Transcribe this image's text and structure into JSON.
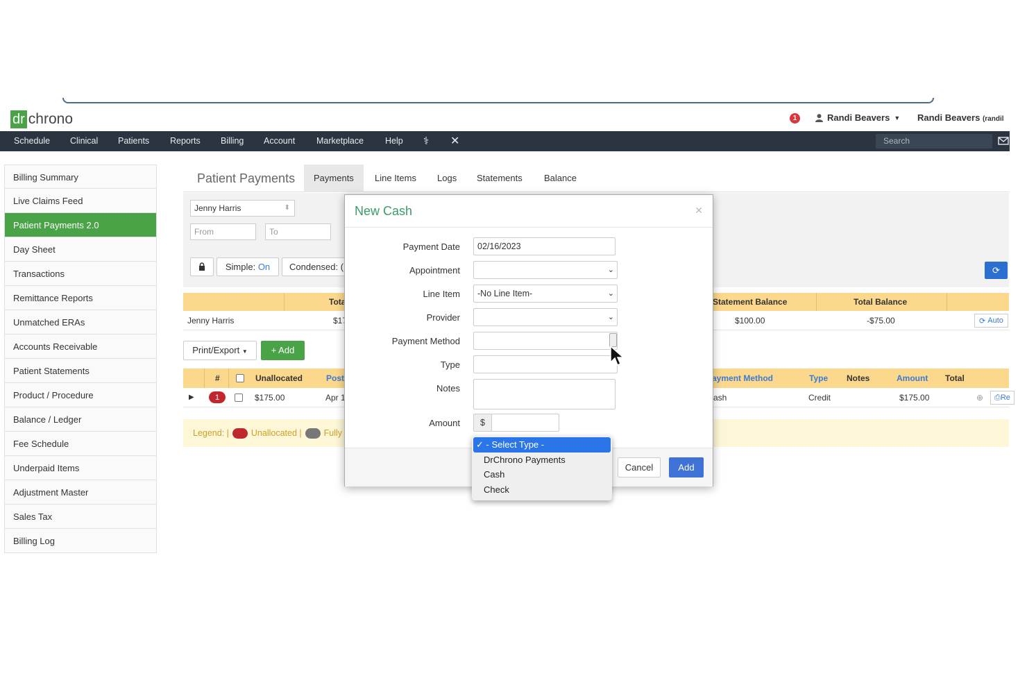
{
  "header": {
    "logo_dr": "dr",
    "logo_chrono": "chrono",
    "alert_count": "1",
    "user_name": "Randi Beavers",
    "user_name2": "Randi Beavers",
    "user_suffix": "(randil"
  },
  "nav": {
    "items": [
      "Schedule",
      "Clinical",
      "Patients",
      "Reports",
      "Billing",
      "Account",
      "Marketplace",
      "Help"
    ],
    "search_placeholder": "Search"
  },
  "sidebar": {
    "items": [
      {
        "label": "Billing Summary"
      },
      {
        "label": "Live Claims Feed"
      },
      {
        "label": "Patient Payments 2.0"
      },
      {
        "label": "Day Sheet"
      },
      {
        "label": "Transactions"
      },
      {
        "label": "Remittance Reports"
      },
      {
        "label": "Unmatched ERAs"
      },
      {
        "label": "Accounts Receivable"
      },
      {
        "label": "Patient Statements"
      },
      {
        "label": "Product / Procedure"
      },
      {
        "label": "Balance / Ledger"
      },
      {
        "label": "Fee Schedule"
      },
      {
        "label": "Underpaid Items"
      },
      {
        "label": "Adjustment Master"
      },
      {
        "label": "Sales Tax"
      },
      {
        "label": "Billing Log"
      }
    ],
    "active_index": 2,
    "accent": "#4aa447"
  },
  "page": {
    "title": "Patient Payments",
    "tabs": [
      "Payments",
      "Line Items",
      "Logs",
      "Statements",
      "Balance"
    ],
    "patient_value": "Jenny Harris",
    "from_placeholder": "From",
    "to_placeholder": "To",
    "simple_label": "Simple:",
    "simple_value": "On",
    "condensed_label": "Condensed: (",
    "print_export": "Print/Export",
    "add_label": "+ Add"
  },
  "summary_table": {
    "headers": {
      "total": "Tota",
      "statement_balance": "Statement Balance",
      "total_balance": "Total Balance"
    },
    "row": {
      "patient": "Jenny Harris",
      "total": "$17",
      "statement_balance": "$100.00",
      "total_balance": "-$75.00",
      "action": "Auto"
    }
  },
  "payments_table": {
    "headers": {
      "num": "#",
      "unallocated": "Unallocated",
      "posted": "Post",
      "payment_method": "ayment Method",
      "type": "Type",
      "notes": "Notes",
      "amount": "Amount",
      "total": "Total"
    },
    "row": {
      "badge": "1",
      "unallocated": "$175.00",
      "posted": "Apr 1",
      "payment_method": "ash",
      "type": "Credit",
      "amount": "$175.00",
      "action": "Re"
    }
  },
  "legend": {
    "label": "Legend: |",
    "unallocated": "Unallocated |",
    "fully": "Fully"
  },
  "modal": {
    "title": "New Cash",
    "fields": {
      "payment_date_label": "Payment Date",
      "payment_date_value": "02/16/2023",
      "appointment_label": "Appointment",
      "appointment_value": "",
      "line_item_label": "Line Item",
      "line_item_value": "-No Line Item-",
      "provider_label": "Provider",
      "provider_value": "",
      "payment_method_label": "Payment Method",
      "type_label": "Type",
      "notes_label": "Notes",
      "amount_label": "Amount",
      "amount_prefix": "$",
      "amount_value": ""
    },
    "cancel_label": "Cancel",
    "add_label": "Add"
  },
  "dropdown": {
    "options": [
      "- Select Type -",
      "DrChrono Payments",
      "Cash",
      "Check"
    ],
    "selected_index": 0
  }
}
